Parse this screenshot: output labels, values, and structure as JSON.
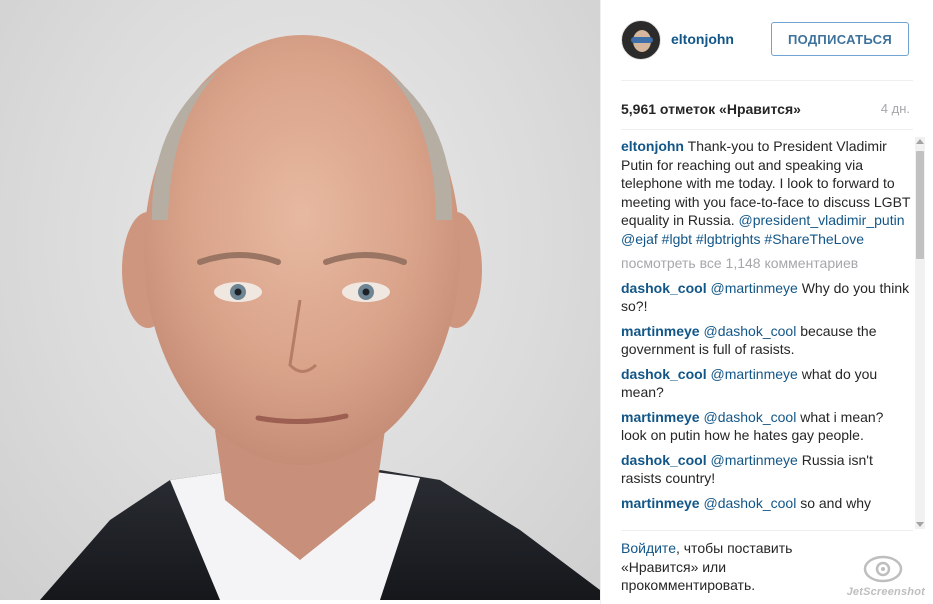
{
  "photo": {
    "alt": "portrait-photo"
  },
  "header": {
    "username": "eltonjohn",
    "follow_label": "ПОДПИСАТЬСЯ"
  },
  "stats": {
    "likes": "5,961 отметок «Нравится»",
    "time": "4 дн."
  },
  "caption": {
    "user": "eltonjohn",
    "text": "Thank-you to President Vladimir Putin for reaching out and speaking via telephone with me today. I look to forward to meeting with you face-to-face to discuss LGBT equality in Russia.",
    "tags": "@president_vladimir_putin @ejaf #lgbt #lgbtrights #ShareTheLove"
  },
  "view_all": "посмотреть все 1,148 комментариев",
  "comments": [
    {
      "user": "dashok_cool",
      "mention": "@martinmeye",
      "text": "Why do you think so?!"
    },
    {
      "user": "martinmeye",
      "mention": "@dashok_cool",
      "text": "because the government is full of rasists."
    },
    {
      "user": "dashok_cool",
      "mention": "@martinmeye",
      "text": "what do you mean?"
    },
    {
      "user": "martinmeye",
      "mention": "@dashok_cool",
      "text": "what i mean? look on putin how he hates gay people."
    },
    {
      "user": "dashok_cool",
      "mention": "@martinmeye",
      "text": "Russia isn't rasists country!"
    },
    {
      "user": "martinmeye",
      "mention": "@dashok_cool",
      "text": "so and why"
    }
  ],
  "login_prompt": {
    "link": "Войдите",
    "text": ", чтобы поставить «Нравится» или прокомментировать."
  },
  "watermark": {
    "text": "JetScreenshot"
  },
  "colors": {
    "link": "#125688",
    "button": "#3f729b",
    "muted": "#a5a7aa"
  }
}
